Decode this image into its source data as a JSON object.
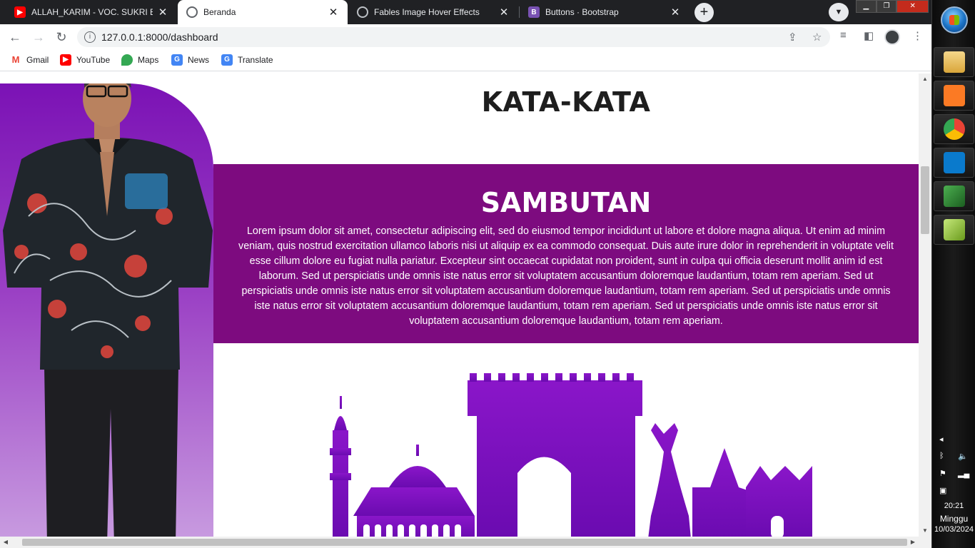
{
  "browser": {
    "tabs": [
      {
        "title": "ALLAH_KARIM - VOC. SUKRI BUD",
        "favicon": "youtube-icon",
        "active": false
      },
      {
        "title": "Beranda",
        "favicon": "globe-icon",
        "active": true
      },
      {
        "title": "Fables Image Hover Effects",
        "favicon": "globe-icon",
        "active": false
      },
      {
        "title": "Buttons · Bootstrap",
        "favicon": "bootstrap-icon",
        "active": false
      }
    ],
    "url": "127.0.0.1:8000/dashboard",
    "bookmarks": [
      {
        "label": "Gmail",
        "icon": "gmail-icon"
      },
      {
        "label": "YouTube",
        "icon": "youtube-icon"
      },
      {
        "label": "Maps",
        "icon": "maps-icon"
      },
      {
        "label": "News",
        "icon": "news-icon"
      },
      {
        "label": "Translate",
        "icon": "translate-icon"
      }
    ]
  },
  "page": {
    "heading": "KATA-KATA",
    "sambutan": {
      "title": "SAMBUTAN",
      "body": "Lorem ipsum dolor sit amet, consectetur adipiscing elit, sed do eiusmod tempor incididunt ut labore et dolore magna aliqua. Ut enim ad minim veniam, quis nostrud exercitation ullamco laboris nisi ut aliquip ex ea commodo consequat. Duis aute irure dolor in reprehenderit in voluptate velit esse cillum dolore eu fugiat nulla pariatur. Excepteur sint occaecat cupidatat non proident, sunt in culpa qui officia deserunt mollit anim id est laborum. Sed ut perspiciatis unde omnis iste natus error sit voluptatem accusantium doloremque laudantium, totam rem aperiam. Sed ut perspiciatis unde omnis iste natus error sit voluptatem accusantium doloremque laudantium, totam rem aperiam. Sed ut perspiciatis unde omnis iste natus error sit voluptatem accusantium doloremque laudantium, totam rem aperiam. Sed ut perspiciatis unde omnis iste natus error sit voluptatem accusantium doloremque laudantium, totam rem aperiam."
    },
    "colors": {
      "sambutan_bg": "#7d0b7f",
      "panel_top": "#7b12b5",
      "skyline": "#8a16c9"
    }
  },
  "taskbar": {
    "apps": [
      "file-explorer-icon",
      "xampp-icon",
      "chrome-icon",
      "vscode-icon",
      "sublime-icon",
      "notepad-icon"
    ],
    "clock": {
      "time": "20:21",
      "day": "Minggu",
      "date": "10/03/2024"
    }
  }
}
